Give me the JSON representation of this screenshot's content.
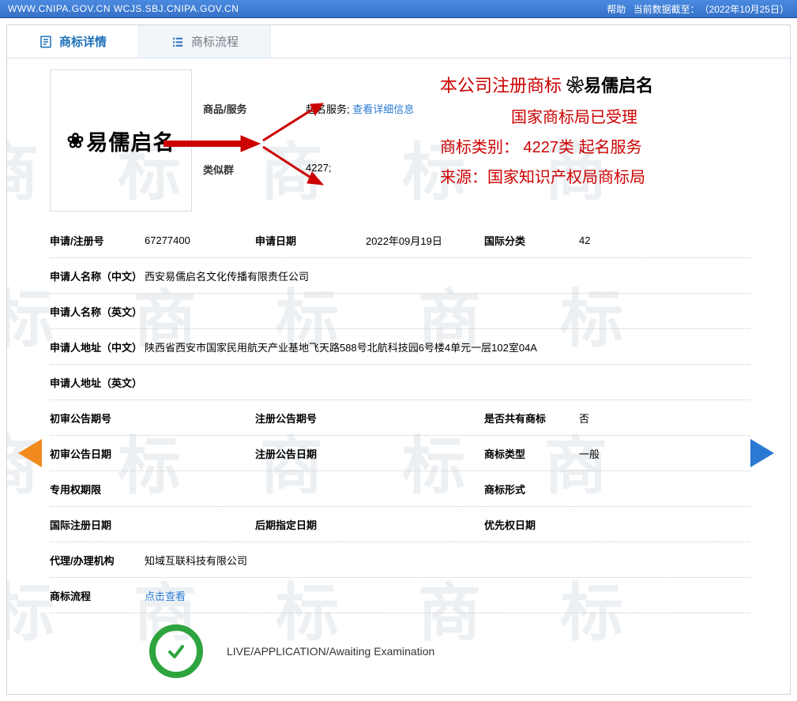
{
  "topbar": {
    "urls": "WWW.CNIPA.GOV.CN WCJS.SBJ.CNIPA.GOV.CN",
    "help": "帮助",
    "cutoff_label": "当前数据截至：",
    "cutoff_date": "（2022年10月25日）"
  },
  "tabs": {
    "detail": "商标详情",
    "process": "商标流程"
  },
  "logo_text": "易儒启名",
  "goods_services": {
    "label": "商品/服务",
    "value": "起名服务;",
    "link": "查看详细信息"
  },
  "similar_group": {
    "label": "类似群",
    "value": "4227;"
  },
  "annotation": {
    "l1_prefix": "本公司注册商标 ",
    "l1_brand": "易儒启名",
    "l2": "国家商标局已受理",
    "l3": "商标类别：  4227类   起名服务",
    "l4": "来源：国家知识产权局商标局"
  },
  "rows": {
    "app_reg_no_lbl": "申请/注册号",
    "app_reg_no": "67277400",
    "app_date_lbl": "申请日期",
    "app_date": "2022年09月19日",
    "intl_class_lbl": "国际分类",
    "intl_class": "42",
    "applicant_cn_lbl": "申请人名称（中文）",
    "applicant_cn": "西安易儒启名文化传播有限责任公司",
    "applicant_en_lbl": "申请人名称（英文）",
    "applicant_en": "",
    "addr_cn_lbl": "申请人地址（中文）",
    "addr_cn": "陕西省西安市国家民用航天产业基地飞天路588号北航科技园6号楼4单元一层102室04A",
    "addr_en_lbl": "申请人地址（英文）",
    "addr_en": "",
    "prelim_ann_no_lbl": "初审公告期号",
    "prelim_ann_no": "",
    "reg_ann_no_lbl": "注册公告期号",
    "reg_ann_no": "",
    "shared_tm_lbl": "是否共有商标",
    "shared_tm": "否",
    "prelim_ann_date_lbl": "初审公告日期",
    "prelim_ann_date": "",
    "reg_ann_date_lbl": "注册公告日期",
    "reg_ann_date": "",
    "tm_type_lbl": "商标类型",
    "tm_type": "一般",
    "excl_right_period_lbl": "专用权期限",
    "excl_right_period": "",
    "tm_form_lbl": "商标形式",
    "tm_form": "",
    "intl_reg_date_lbl": "国际注册日期",
    "intl_reg_date": "",
    "late_desig_date_lbl": "后期指定日期",
    "late_desig_date": "",
    "priority_date_lbl": "优先权日期",
    "priority_date": "",
    "agency_lbl": "代理/办理机构",
    "agency": "知域互联科技有限公司",
    "process_lbl": "商标流程",
    "process_link": "点击查看"
  },
  "status_text": "LIVE/APPLICATION/Awaiting Examination",
  "watermark": "商标 商标 商标"
}
